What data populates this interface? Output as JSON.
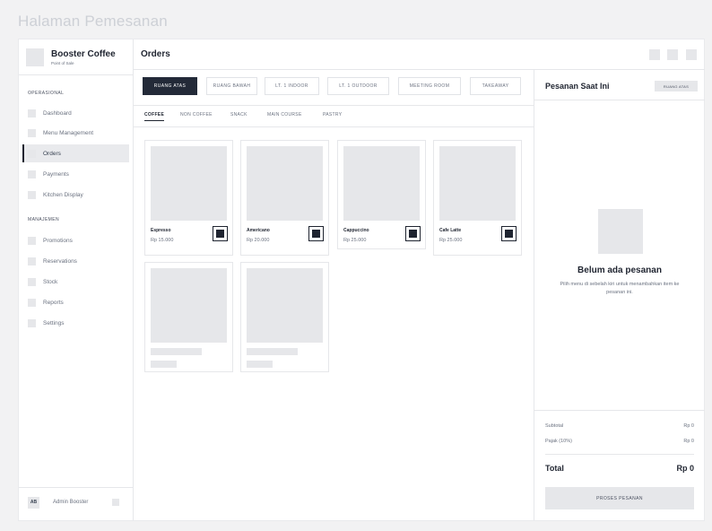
{
  "page": {
    "heading": "Halaman Pemesanan"
  },
  "brand": {
    "name": "Booster Coffee",
    "subtitle": "Point of Sale"
  },
  "sidebar": {
    "sections": [
      {
        "label": "OPERASIONAL"
      },
      {
        "label": "MANAJEMEN"
      }
    ],
    "items": [
      {
        "label": "Dashboard",
        "icon": "dashboard-icon"
      },
      {
        "label": "Menu Management",
        "icon": "menu-icon"
      },
      {
        "label": "Orders",
        "icon": "orders-icon",
        "active": true
      },
      {
        "label": "Payments",
        "icon": "payments-icon"
      },
      {
        "label": "Kitchen Display",
        "icon": "kitchen-icon"
      },
      {
        "label": "Promotions",
        "icon": "promotions-icon"
      },
      {
        "label": "Reservations",
        "icon": "reservations-icon"
      },
      {
        "label": "Stock",
        "icon": "stock-icon"
      },
      {
        "label": "Reports",
        "icon": "reports-icon"
      },
      {
        "label": "Settings",
        "icon": "settings-icon"
      }
    ]
  },
  "user": {
    "initials": "AB",
    "name": "Admin Booster"
  },
  "header": {
    "title": "Orders"
  },
  "room_tabs": [
    {
      "label": "RUANG ATAS",
      "active": true
    },
    {
      "label": "RUANG BAWAH"
    },
    {
      "label": "LT. 1 INDOOR"
    },
    {
      "label": "LT. 1 OUTDOOR"
    },
    {
      "label": "MEETING ROOM"
    },
    {
      "label": "TAKEAWAY"
    }
  ],
  "category_tabs": [
    {
      "label": "COFFEE",
      "active": true
    },
    {
      "label": "NON COFFEE"
    },
    {
      "label": "SNACK"
    },
    {
      "label": "MAIN COURSE"
    },
    {
      "label": "PASTRY"
    }
  ],
  "products": [
    {
      "name": "Espresso",
      "price": "Rp 15.000"
    },
    {
      "name": "Americano",
      "price": "Rp 20.000"
    },
    {
      "name": "Cappuccino",
      "price": "Rp 25.000"
    },
    {
      "name": "Cafe Latte",
      "price": "Rp 25.000"
    }
  ],
  "panel": {
    "title": "Pesanan Saat Ini",
    "badge": "RUANG ATAS",
    "empty_title": "Belum ada pesanan",
    "empty_desc": "Pilih menu di sebelah kiri untuk menambahkan item ke pesanan ini.",
    "subtotal_label": "Subtotal",
    "subtotal_value": "Rp 0",
    "tax_label": "Pajak (10%)",
    "tax_value": "Rp 0",
    "total_label": "Total",
    "total_value": "Rp 0",
    "checkout_label": "PROSES PESANAN"
  },
  "colors": {
    "accent": "#232a38",
    "placeholder": "#e6e7ea",
    "border": "#e6e7ea"
  }
}
